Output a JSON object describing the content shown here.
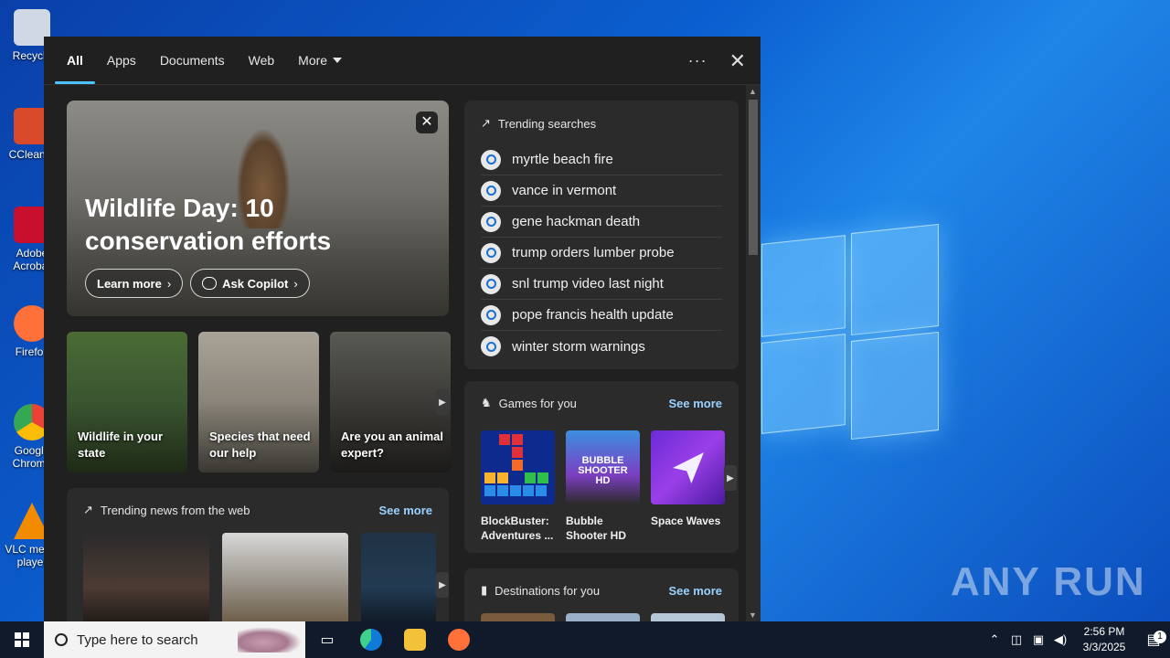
{
  "desktop": {
    "icons": [
      {
        "label": "Recycle",
        "color": "#cfd8e3"
      },
      {
        "label": "CCleaner",
        "color": "#d94a2b"
      },
      {
        "label": "Adobe Acrobat",
        "color": "#c8102e"
      },
      {
        "label": "Firefox",
        "color": "#ff7139"
      },
      {
        "label": "Google Chrome",
        "color": "#34a853"
      },
      {
        "label": "VLC media player",
        "color": "#f28b00"
      }
    ],
    "watermark": "ANY RUN"
  },
  "search_panel": {
    "tabs": [
      {
        "label": "All",
        "active": true
      },
      {
        "label": "Apps"
      },
      {
        "label": "Documents"
      },
      {
        "label": "Web"
      },
      {
        "label": "More"
      }
    ],
    "hero": {
      "title": "Wildlife Day: 10 conservation efforts",
      "learn_more": "Learn more",
      "ask_copilot": "Ask Copilot"
    },
    "tiles": [
      {
        "label": "Wildlife in your state"
      },
      {
        "label": "Species that need our help"
      },
      {
        "label": "Are you an animal expert?"
      }
    ],
    "trending_news": {
      "title": "Trending news from the web",
      "see_more": "See more"
    },
    "trending_searches": {
      "title": "Trending searches",
      "items": [
        "myrtle beach fire",
        "vance in vermont",
        "gene hackman death",
        "trump orders lumber probe",
        "snl trump video last night",
        "pope francis health update",
        "winter storm warnings"
      ]
    },
    "games": {
      "title": "Games for you",
      "see_more": "See more",
      "items": [
        {
          "name": "BlockBuster: Adventures ..."
        },
        {
          "name": "Bubble Shooter HD",
          "art_text": "BUBBLE SHOOTER HD"
        },
        {
          "name": "Space Waves"
        }
      ]
    },
    "destinations": {
      "title": "Destinations for you",
      "see_more": "See more"
    }
  },
  "taskbar": {
    "search_placeholder": "Type here to search",
    "time": "2:56 PM",
    "date": "3/3/2025",
    "notification_count": "1"
  },
  "colors": {
    "accent": "#4cc2ff",
    "link": "#99d1ff",
    "panel_bg": "#202020",
    "card_bg": "#2b2b2b"
  }
}
